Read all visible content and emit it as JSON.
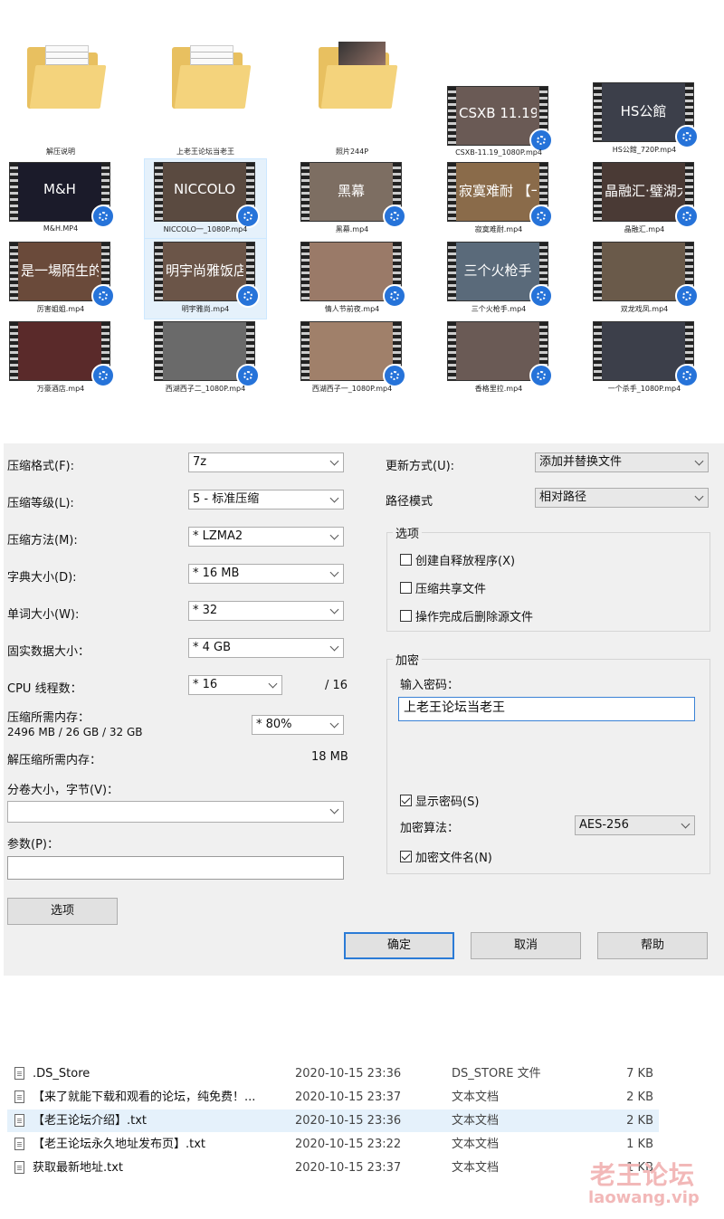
{
  "explorer": {
    "items": [
      {
        "name": "解压说明",
        "kind": "folder-docs"
      },
      {
        "name": "上老王论坛当老王",
        "kind": "folder-docs"
      },
      {
        "name": "照片244P",
        "kind": "folder-photos"
      },
      {
        "name": "CSXB-11.19_1080P.mp4",
        "thumb_text": "CSXB 11.19"
      },
      {
        "name": "HS公館_720P.mp4",
        "thumb_text": "HS公館"
      },
      {
        "name": "M&H.MP4",
        "thumb_text": "M&H"
      },
      {
        "name": "NICCOLO一_1080P.mp4",
        "thumb_text": "NICCOLO"
      },
      {
        "name": "黑幕.mp4",
        "thumb_text": "黑幕"
      },
      {
        "name": "寂寞难耐.mp4",
        "thumb_text": "寂寞难耐 【一】"
      },
      {
        "name": "晶融汇.mp4",
        "thumb_text": "晶融汇·璧湖大战大屌"
      },
      {
        "name": "厉害姐姐.mp4",
        "thumb_text": "是一場陌生的期"
      },
      {
        "name": "明宇雅尚.mp4",
        "thumb_text": "明宇尚雅饭店"
      },
      {
        "name": "情人节前夜.mp4",
        "thumb_text": ""
      },
      {
        "name": "三个火枪手.mp4",
        "thumb_text": "三个火枪手"
      },
      {
        "name": "双龙戏凤.mp4",
        "thumb_text": ""
      },
      {
        "name": "万豪酒店.mp4",
        "thumb_text": ""
      },
      {
        "name": "西湖西子二_1080P.mp4",
        "thumb_text": ""
      },
      {
        "name": "西湖西子一_1080P.mp4",
        "thumb_text": ""
      },
      {
        "name": "香格里拉.mp4",
        "thumb_text": ""
      },
      {
        "name": "一个杀手_1080P.mp4",
        "thumb_text": ""
      }
    ]
  },
  "dialog": {
    "format_label": "压缩格式(F):",
    "format_value": "7z",
    "level_label": "压缩等级(L):",
    "level_value": "5 - 标准压缩",
    "method_label": "压缩方法(M):",
    "method_value": "* LZMA2",
    "dict_label": "字典大小(D):",
    "dict_value": "* 16 MB",
    "word_label": "单词大小(W):",
    "word_value": "* 32",
    "solid_label": "固实数据大小：",
    "solid_value": "* 4 GB",
    "threads_label": "CPU 线程数：",
    "threads_value": "* 16",
    "threads_total": "/ 16",
    "mem_label": "压缩所需内存：",
    "mem_value": "2496 MB / 26 GB / 32 GB",
    "mem_pct": "* 80%",
    "decomp_label": "解压缩所需内存：",
    "decomp_value": "18 MB",
    "volume_label": "分卷大小，字节(V)：",
    "volume_value": "",
    "params_label": "参数(P)：",
    "params_value": "",
    "options_button": "选项",
    "update_label": "更新方式(U):",
    "update_value": "添加并替换文件",
    "path_label": "路径模式",
    "path_value": "相对路径",
    "options_group": "选项",
    "opt_sfx": "创建自释放程序(X)",
    "opt_sfx_checked": false,
    "opt_shared": "压缩共享文件",
    "opt_shared_checked": false,
    "opt_delete": "操作完成后删除源文件",
    "opt_delete_checked": false,
    "encryption_group": "加密",
    "password_label": "输入密码：",
    "password_value": "上老王论坛当老王",
    "show_password": "显示密码(S)",
    "show_password_checked": true,
    "enc_method_label": "加密算法：",
    "enc_method_value": "AES-256",
    "enc_names": "加密文件名(N)",
    "enc_names_checked": true,
    "ok": "确定",
    "cancel": "取消",
    "help": "帮助"
  },
  "file_list": [
    {
      "name": ".DS_Store",
      "date": "2020-10-15 23:36",
      "type": "DS_STORE 文件",
      "size": "7 KB"
    },
    {
      "name": "【来了就能下载和观看的论坛，纯免费！...",
      "date": "2020-10-15 23:37",
      "type": "文本文档",
      "size": "2 KB"
    },
    {
      "name": "【老王论坛介绍】.txt",
      "date": "2020-10-15 23:36",
      "type": "文本文档",
      "size": "2 KB",
      "selected": true
    },
    {
      "name": "【老王论坛永久地址发布页】.txt",
      "date": "2020-10-15 23:22",
      "type": "文本文档",
      "size": "1 KB"
    },
    {
      "name": "获取最新地址.txt",
      "date": "2020-10-15 23:37",
      "type": "文本文档",
      "size": "1 KB"
    }
  ],
  "watermark": {
    "title": "老王论坛",
    "url": "laowang.vip"
  },
  "colors": {
    "accent": "#2b7bd6",
    "selection": "#e5f1fb",
    "watermark": "#f2b8b8"
  }
}
